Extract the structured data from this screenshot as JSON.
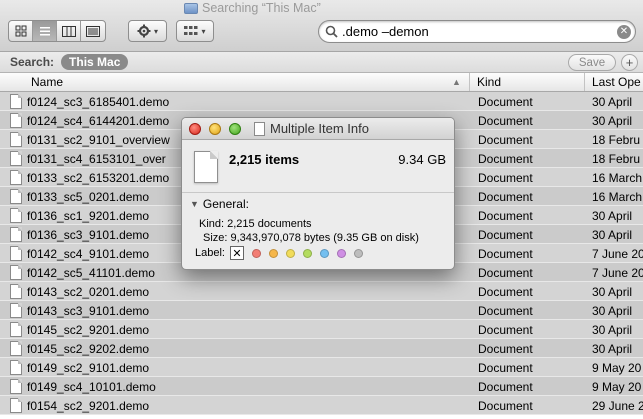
{
  "window": {
    "title": "Searching “This Mac”"
  },
  "toolbar": {
    "view_buttons": [
      {
        "name": "icon-view-button",
        "glyph": "☷",
        "active": false
      },
      {
        "name": "list-view-button",
        "glyph": "☰",
        "active": true
      },
      {
        "name": "column-view-button",
        "glyph": "❙❙❙",
        "active": false
      },
      {
        "name": "coverflow-view-button",
        "glyph": "▐▐",
        "active": false
      }
    ],
    "action_icon": "gear-icon",
    "arrange_icon": "grid-icon",
    "search": {
      "value": ".demo –demon",
      "placeholder": ""
    }
  },
  "scope": {
    "label": "Search:",
    "selected": "This Mac",
    "save_label": "Save",
    "add_label": "+"
  },
  "columns": {
    "name": "Name",
    "kind": "Kind",
    "date": "Last Ope"
  },
  "rows": [
    {
      "name": "f0124_sc3_6185401.demo",
      "kind": "Document",
      "date": "30 April"
    },
    {
      "name": "f0124_sc4_6144201.demo",
      "kind": "Document",
      "date": "30 April"
    },
    {
      "name": "f0131_sc2_9101_overview",
      "kind": "Document",
      "date": "18 Febru"
    },
    {
      "name": "f0131_sc4_6153101_over",
      "kind": "Document",
      "date": "18 Febru"
    },
    {
      "name": "f0133_sc2_6153201.demo",
      "kind": "Document",
      "date": "16 March"
    },
    {
      "name": "f0133_sc5_0201.demo",
      "kind": "Document",
      "date": "16 March"
    },
    {
      "name": "f0136_sc1_9201.demo",
      "kind": "Document",
      "date": "30 April"
    },
    {
      "name": "f0136_sc3_9101.demo",
      "kind": "Document",
      "date": "30 April"
    },
    {
      "name": "f0142_sc4_9101.demo",
      "kind": "Document",
      "date": "7 June 20"
    },
    {
      "name": "f0142_sc5_41101.demo",
      "kind": "Document",
      "date": "7 June 20"
    },
    {
      "name": "f0143_sc2_0201.demo",
      "kind": "Document",
      "date": "30 April"
    },
    {
      "name": "f0143_sc3_9101.demo",
      "kind": "Document",
      "date": "30 April"
    },
    {
      "name": "f0145_sc2_9201.demo",
      "kind": "Document",
      "date": "30 April"
    },
    {
      "name": "f0145_sc2_9202.demo",
      "kind": "Document",
      "date": "30 April"
    },
    {
      "name": "f0149_sc2_9101.demo",
      "kind": "Document",
      "date": "9 May 20"
    },
    {
      "name": "f0149_sc4_10101.demo",
      "kind": "Document",
      "date": "9 May 20"
    },
    {
      "name": "f0154_sc2_9201.demo",
      "kind": "Document",
      "date": "29 June 2"
    }
  ],
  "info": {
    "title": "Multiple Item Info",
    "items": "2,215 items",
    "size": "9.34 GB",
    "general_label": "General:",
    "kind_line": "Kind: 2,215 documents",
    "size_line": "Size: 9,343,970,078 bytes (9.35 GB on disk)",
    "label_label": "Label:",
    "label_none": "✕",
    "label_colors": [
      "#f27d74",
      "#f5b64a",
      "#f1dc5a",
      "#b4dc5f",
      "#74bff0",
      "#cf8fe4",
      "#bdbdbd"
    ]
  }
}
